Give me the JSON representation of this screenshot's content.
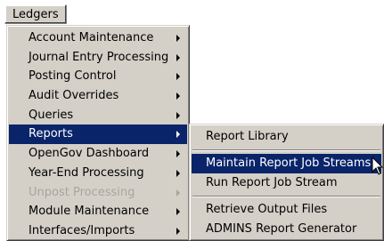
{
  "menubar": {
    "ledgers_label": "Ledgers"
  },
  "main_menu": {
    "items": [
      {
        "label": "Account Maintenance",
        "submenu": true,
        "state": "normal"
      },
      {
        "label": "Journal Entry Processing",
        "submenu": true,
        "state": "normal"
      },
      {
        "label": "Posting Control",
        "submenu": true,
        "state": "normal"
      },
      {
        "label": "Audit Overrides",
        "submenu": true,
        "state": "normal"
      },
      {
        "label": "Queries",
        "submenu": true,
        "state": "normal"
      },
      {
        "label": "Reports",
        "submenu": true,
        "state": "highlighted"
      },
      {
        "label": "OpenGov Dashboard",
        "submenu": true,
        "state": "normal"
      },
      {
        "label": "Year-End Processing",
        "submenu": true,
        "state": "normal"
      },
      {
        "label": "Unpost Processing",
        "submenu": true,
        "state": "disabled"
      },
      {
        "label": "Module Maintenance",
        "submenu": true,
        "state": "normal"
      },
      {
        "label": "Interfaces/Imports",
        "submenu": true,
        "state": "normal"
      }
    ]
  },
  "reports_submenu": {
    "report_library": "Report Library",
    "maintain_job_streams": "Maintain Report Job Streams",
    "run_job_stream": "Run Report Job Stream",
    "retrieve_output": "Retrieve Output Files",
    "admins_generator": "ADMINS Report Generator"
  },
  "colors": {
    "menu_face": "#d4d0c8",
    "highlight": "#0a246a",
    "highlight_text": "#ffffff",
    "disabled_text": "#a8a5a0"
  },
  "icons": {
    "submenu_arrow": "chevron-right-icon",
    "pointer": "mouse-cursor-icon"
  }
}
